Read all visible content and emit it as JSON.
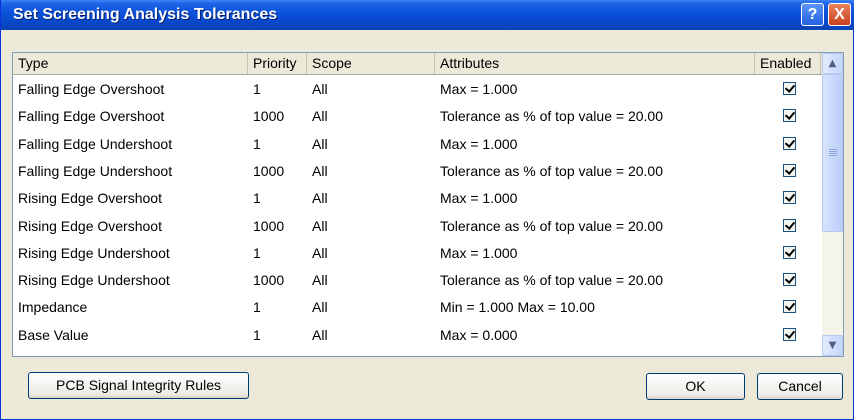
{
  "window": {
    "title": "Set Screening Analysis Tolerances"
  },
  "titlebar_buttons": {
    "help": "?",
    "close": "X"
  },
  "table": {
    "columns": [
      "Type",
      "Priority",
      "Scope",
      "Attributes",
      "Enabled"
    ],
    "rows": [
      {
        "type": "Falling Edge Overshoot",
        "priority": "1",
        "scope": "All",
        "attributes": "Max =  1.000",
        "enabled": true
      },
      {
        "type": "Falling Edge Overshoot",
        "priority": "1000",
        "scope": "All",
        "attributes": "Tolerance as % of top value =  20.00",
        "enabled": true
      },
      {
        "type": "Falling Edge Undershoot",
        "priority": "1",
        "scope": "All",
        "attributes": "Max =  1.000",
        "enabled": true
      },
      {
        "type": "Falling Edge Undershoot",
        "priority": "1000",
        "scope": "All",
        "attributes": "Tolerance as % of top value =  20.00",
        "enabled": true
      },
      {
        "type": "Rising Edge Overshoot",
        "priority": "1",
        "scope": "All",
        "attributes": "Max =  1.000",
        "enabled": true
      },
      {
        "type": "Rising Edge Overshoot",
        "priority": "1000",
        "scope": "All",
        "attributes": "Tolerance as % of top value =  20.00",
        "enabled": true
      },
      {
        "type": "Rising Edge Undershoot",
        "priority": "1",
        "scope": "All",
        "attributes": "Max =  1.000",
        "enabled": true
      },
      {
        "type": "Rising Edge Undershoot",
        "priority": "1000",
        "scope": "All",
        "attributes": "Tolerance as % of top value =  20.00",
        "enabled": true
      },
      {
        "type": "Impedance",
        "priority": "1",
        "scope": "All",
        "attributes": "Min =  1.000 Max =  10.00",
        "enabled": true
      },
      {
        "type": "Base Value",
        "priority": "1",
        "scope": "All",
        "attributes": "Max =  0.000",
        "enabled": true
      }
    ]
  },
  "buttons": {
    "pcb_rules": "PCB Signal Integrity Rules",
    "ok": "OK",
    "cancel": "Cancel"
  },
  "colors": {
    "titlebar": "#0a54dc",
    "dialog_bg": "#ece9d8",
    "close_button": "#c8401c"
  }
}
